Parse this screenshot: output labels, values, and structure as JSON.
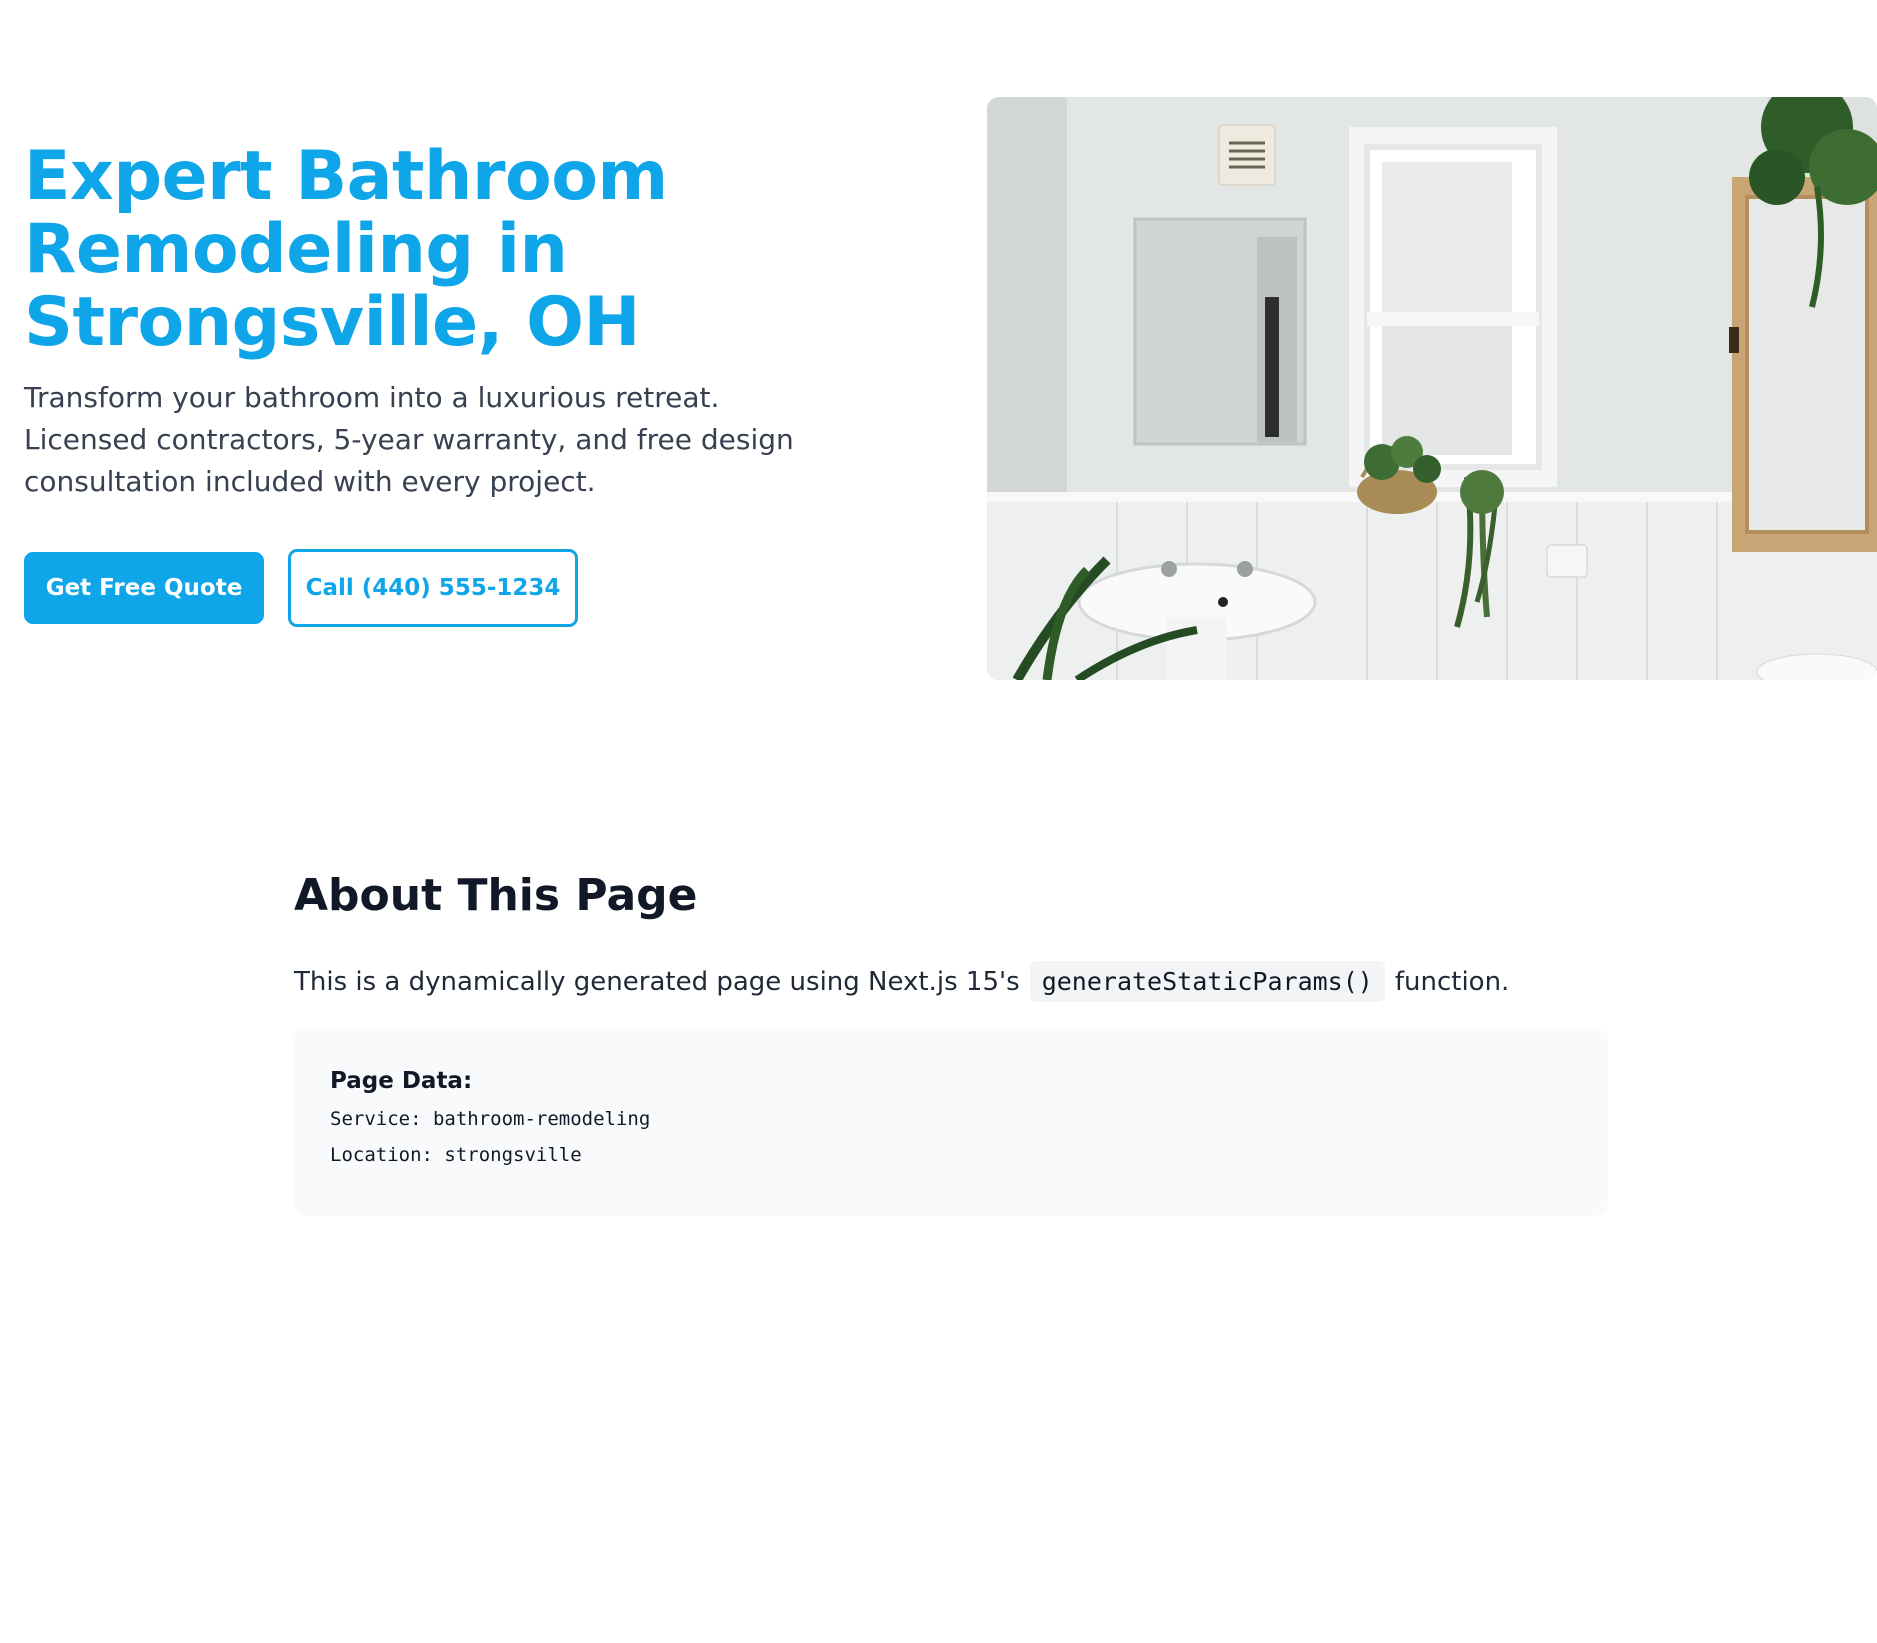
{
  "hero": {
    "title": "Expert Bathroom Remodeling in Strongsville, OH",
    "subtitle": "Transform your bathroom into a luxurious retreat. Licensed contractors, 5-year warranty, and free design consultation included with every project.",
    "primary_button": "Get Free Quote",
    "secondary_button": "Call (440) 555-1234",
    "image_icon": "bathroom-photo"
  },
  "about": {
    "title": "About This Page",
    "text_before": "This is a dynamically generated page using Next.js 15's",
    "code": "generateStaticParams()",
    "text_after": "function.",
    "data_title": "Page Data:",
    "service_line": "Service: bathroom-remodeling",
    "location_line": "Location: strongsville"
  },
  "colors": {
    "accent": "#0ea5e9",
    "heading": "#111827",
    "box_bg": "#f9fafb"
  }
}
